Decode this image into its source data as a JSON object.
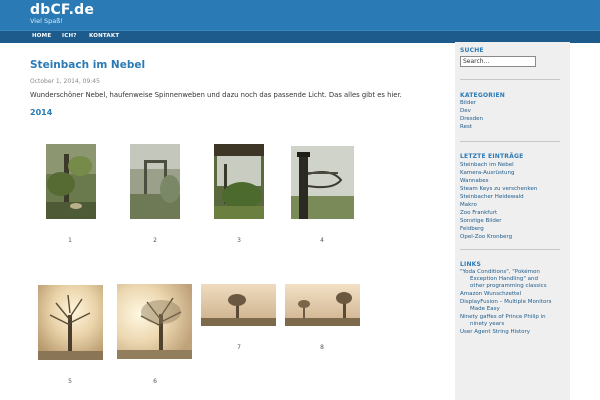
{
  "site": {
    "title": "dbCF.de",
    "description": "Viel Spaß!"
  },
  "nav": [
    {
      "label": "HOME"
    },
    {
      "label": "ICH?"
    },
    {
      "label": "KONTAKT"
    }
  ],
  "post": {
    "title": "Steinbach im Nebel",
    "date": "October 1, 2014, 09:45",
    "text": "Wunderschöner Nebel, haufenweise Spinnenweben und dazu noch das passende Licht. Das alles gibt es hier.",
    "gallery_heading": "2014",
    "captions": [
      "1",
      "2",
      "3",
      "4",
      "5",
      "6",
      "7",
      "8"
    ]
  },
  "sidebar": {
    "search": {
      "heading": "SUCHE",
      "placeholder": "Search..."
    },
    "categories": {
      "heading": "KATEGORIEN",
      "items": [
        "Bilder",
        "Dev",
        "Dresden",
        "Rest"
      ]
    },
    "recent": {
      "heading": "LETZTE EINTRÄGE",
      "items": [
        "Steinbach im Nebel",
        "Kamera-Ausrüstung",
        "Wannabes",
        "Steam Keys zu verschenken",
        "Steinbacher Heidewald",
        "Makro",
        "Zoo Frankfurt",
        "Sonstige Bilder",
        "Feldberg",
        "Opel-Zoo Kronberg"
      ]
    },
    "links": {
      "heading": "LINKS",
      "item1_line1": "\"Yoda Conditions\", \"Pokémon",
      "item1_line2": "Exception Handling\" and",
      "item1_line3": "other programming classics",
      "item2": "Amazon Wunschzettel",
      "item3_line1": "DisplayFusion – Multiple Monitors",
      "item3_line2": "Made Easy",
      "item4_line1": "Ninety gaffes of Prince Philip in",
      "item4_line2": "ninety years",
      "item5": "User Agent String History"
    }
  },
  "colors": {
    "header": "#2a7ab6",
    "nav": "#1d5b8c",
    "sidebar": "#efefef",
    "accent": "#2a7ab6"
  }
}
